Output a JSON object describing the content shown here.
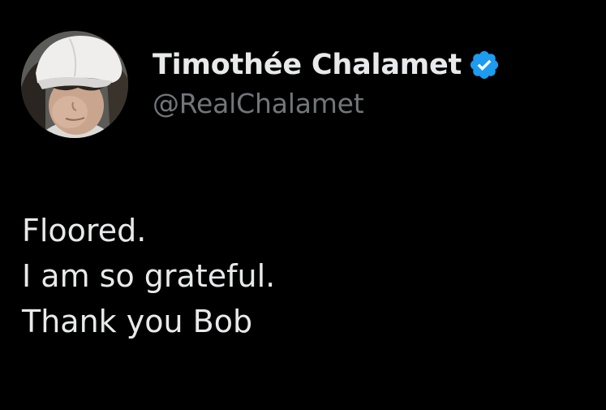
{
  "author": {
    "display_name": "Timothée Chalamet",
    "handle": "@RealChalamet",
    "verified": true,
    "verified_badge_color": "#1d9bf0",
    "avatar_icon": "profile-photo-white-cap"
  },
  "tweet": {
    "lines": [
      "Floored.",
      "I am so grateful.",
      "Thank you Bob"
    ]
  },
  "colors": {
    "background": "#000000",
    "primary_text": "#e7e9ea",
    "secondary_text": "#71767b"
  }
}
